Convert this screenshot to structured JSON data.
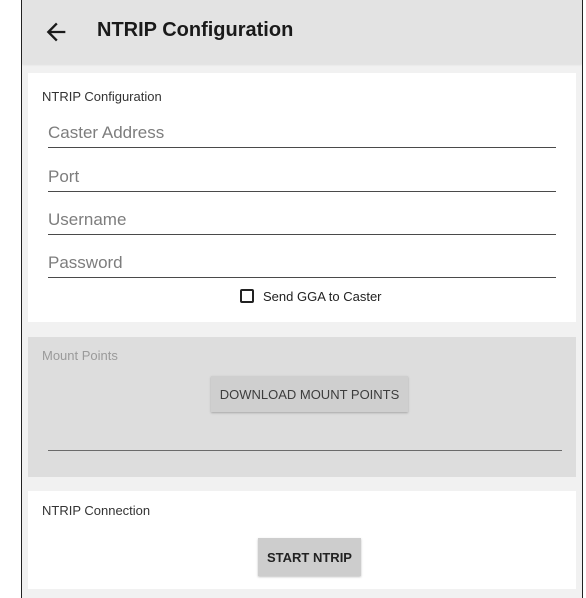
{
  "appbar": {
    "title": "NTRIP Configuration",
    "back_icon": "arrow-left-icon"
  },
  "config": {
    "label": "NTRIP Configuration",
    "caster_placeholder": "Caster Address",
    "port_placeholder": "Port",
    "username_placeholder": "Username",
    "password_placeholder": "Password",
    "send_gga_label": "Send GGA to Caster",
    "send_gga_checked": false
  },
  "mount": {
    "label": "Mount Points",
    "download_label": "DOWNLOAD MOUNT POINTS"
  },
  "connection": {
    "label": "NTRIP Connection",
    "start_label": "START NTRIP"
  }
}
